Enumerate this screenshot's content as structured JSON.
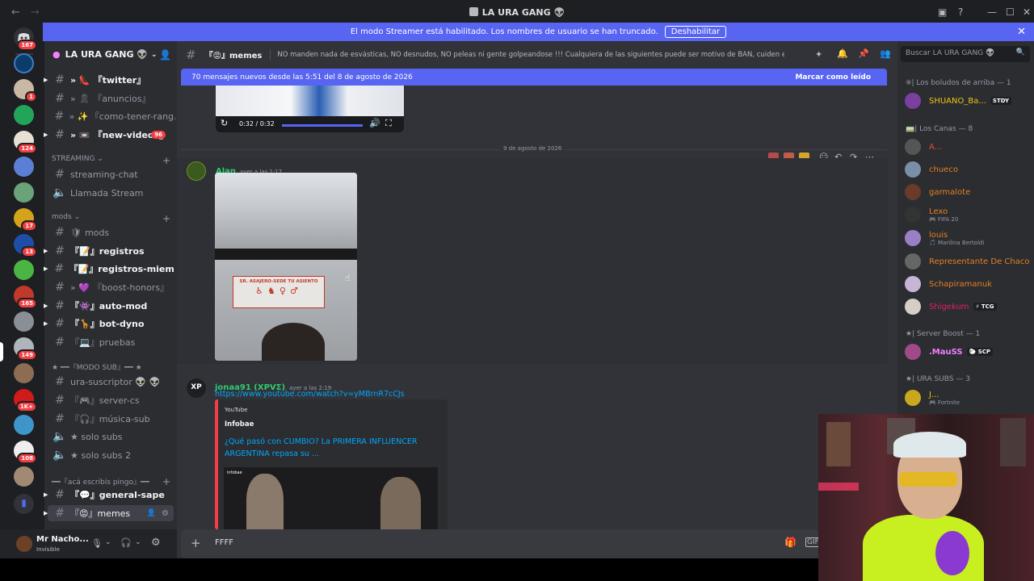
{
  "titlebar": {
    "title": "LA URA GANG 👽"
  },
  "streamer_bar": {
    "text": "El modo Streamer está habilitado. Los nombres de usuario se han truncado.",
    "button": "Deshabilitar"
  },
  "servers": {
    "dm_badge": "167",
    "badges": [
      "1",
      "124",
      "17",
      "13",
      "165",
      "149",
      "1K+",
      "108"
    ]
  },
  "guild": {
    "name": "LA URA GANG 👽"
  },
  "channels": [
    {
      "name": "『twitter』",
      "prefix": "» 👠",
      "unread": true
    },
    {
      "name": "『anuncios』",
      "prefix": "» 🎗",
      "unread": false
    },
    {
      "name": "『como-tener-rang...",
      "prefix": "» ✨",
      "unread": false
    },
    {
      "name": "『new-videos』",
      "prefix": "» 📼",
      "unread": true,
      "count": "96"
    }
  ],
  "categories": {
    "streaming": "STREAMING",
    "mods": "mods",
    "modo_sub": "★ ━━『MODO SUB』━━ ★",
    "aca": "━━『acá escribís pingo』━━"
  },
  "streaming_channels": [
    {
      "name": "streaming-chat",
      "type": "text"
    },
    {
      "name": "Llamada Stream",
      "type": "voice"
    }
  ],
  "mods_channels": [
    {
      "name": "mods",
      "prefix": "🛡",
      "unread": false
    },
    {
      "name": "『📝』registros",
      "unread": true
    },
    {
      "name": "『📝』registros-miem...",
      "unread": true
    },
    {
      "name": "『boost-honors』",
      "prefix": "» 💜",
      "unread": false
    },
    {
      "name": "『👾』auto-mod",
      "unread": true
    },
    {
      "name": "『🦒』bot-dyno",
      "unread": true
    },
    {
      "name": "『💻』pruebas",
      "unread": false
    }
  ],
  "sub_channels": [
    {
      "name": "ura-suscriptor 👽 👽",
      "type": "text"
    },
    {
      "name": "『🎮』server-cs",
      "type": "text"
    },
    {
      "name": "『🎧』música-sub",
      "type": "text"
    },
    {
      "name": "★ solo subs",
      "type": "voice"
    },
    {
      "name": "★ solo subs 2",
      "type": "voice"
    }
  ],
  "aca_channels": [
    {
      "name": "『💬』general-sape",
      "unread": true
    },
    {
      "name": "『😡』memes",
      "active": true
    }
  ],
  "user": {
    "name": "Mr Nacho...",
    "status": "Invisible"
  },
  "channel_header": {
    "name": "『😡』memes",
    "topic": "NO manden nada de esvásticas, NO desnudos, NO peleas ni gente golpeandose !!! Cualquiera de las siguientes puede ser motivo de BAN, cuiden el stream!"
  },
  "new_messages": {
    "text": "70 mensajes nuevos desde las 5:51 del 8 de agosto de 2026",
    "mark": "Marcar como leído"
  },
  "video_time": "0:32 / 0:32",
  "date_divider": "9 de agosto de 2026",
  "messages": [
    {
      "author": "Alan",
      "time": "ayer a las 1:17",
      "author_color": "#2ecc71"
    },
    {
      "author": "jonaa91 (XPVΣ)",
      "time": "ayer a las 2:19",
      "author_color": "#2ecc71",
      "link": "https://www.youtube.com/watch?v=yMBrnR7cCJs",
      "embed": {
        "provider": "YouTube",
        "author": "Infobae",
        "title": "¿Qué pasó con CUMBIO? La PRIMERA INFLUENCER ARGENTINA repasa su ...",
        "thumb_label": "infobae"
      }
    }
  ],
  "bus_sign": "SR. ASAJERO-SEDE TU ASIENTO",
  "composer": {
    "value": "FFFF"
  },
  "member_search": {
    "placeholder": "Buscar LA URA GANG 👽"
  },
  "member_sections": [
    {
      "title": "※| Los boludos de arriba — 1"
    },
    {
      "title": "🚃| Los Canas — 8"
    },
    {
      "title": "★| Server Boost — 1"
    },
    {
      "title": "★| URA SUBS — 3"
    }
  ],
  "members": [
    {
      "name": "SHUANO_Ba...",
      "color": "#f1c40f",
      "tag": "STDY",
      "sub": ""
    },
    {
      "name": "A...",
      "color": "#e74c3c",
      "tag": "",
      "sub": ""
    },
    {
      "name": "chueco",
      "color": "#e67e22",
      "tag": "",
      "sub": ""
    },
    {
      "name": "garmalote",
      "color": "#e67e22",
      "tag": "",
      "sub": ""
    },
    {
      "name": "Lexo",
      "color": "#e67e22",
      "tag": "",
      "sub": "🎮 FIFA 20"
    },
    {
      "name": "louis",
      "color": "#e67e22",
      "tag": "",
      "sub": "🎵 Marilina Bertoldi"
    },
    {
      "name": "Representante De Chaco",
      "color": "#e67e22",
      "tag": "",
      "sub": ""
    },
    {
      "name": "Schapiramanuk",
      "color": "#e67e22",
      "tag": "",
      "sub": ""
    },
    {
      "name": "Shigekum",
      "color": "#e91e63",
      "tag": "⚡ TCG",
      "sub": ""
    },
    {
      "name": ".MauSS",
      "color": "#f47fff",
      "tag": "🐑 SCP",
      "sub": ""
    },
    {
      "name": "J...",
      "color": "#f1c40f",
      "tag": "",
      "sub": "🎮 Fortnite"
    }
  ]
}
